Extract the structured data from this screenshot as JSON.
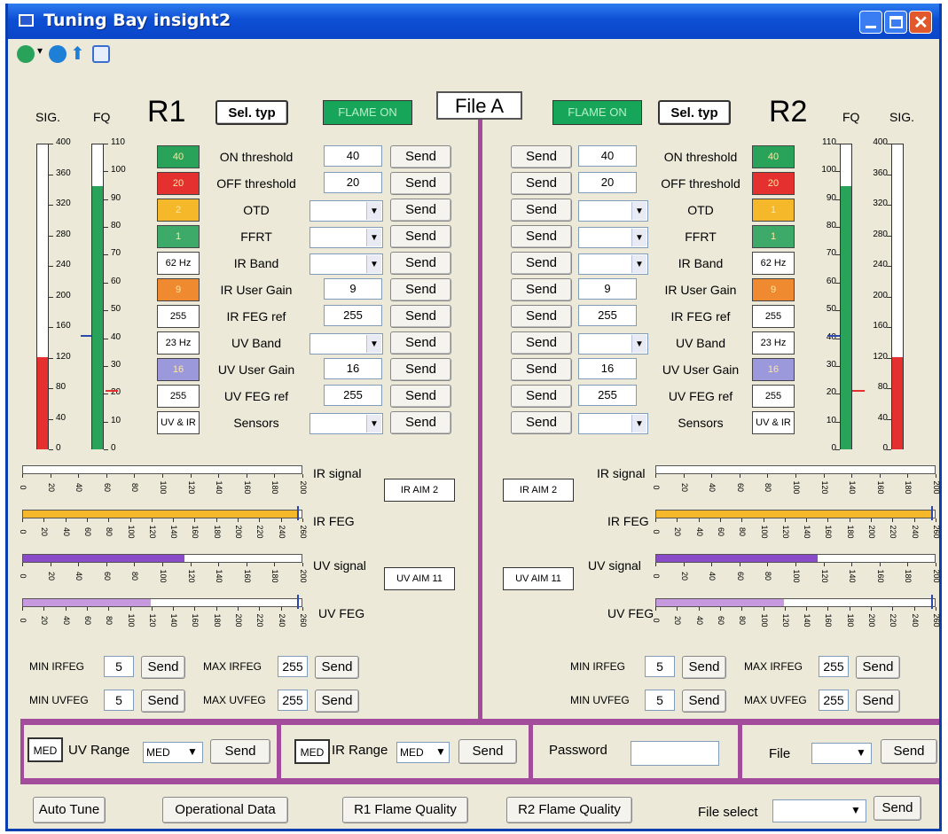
{
  "window": {
    "title": "Tuning Bay insight2"
  },
  "header": {
    "sig": "SIG.",
    "fq": "FQ",
    "r1": "R1",
    "r2": "R2",
    "sel_typ": "Sel. typ",
    "flame_on": "FLAME ON",
    "file": "File A"
  },
  "sig_scale": [
    "400",
    "360",
    "320",
    "280",
    "240",
    "200",
    "160",
    "120",
    "80",
    "40",
    "0"
  ],
  "fq_scale": [
    "110",
    "100",
    "90",
    "80",
    "70",
    "60",
    "50",
    "40",
    "30",
    "20",
    "10",
    "0"
  ],
  "levels": {
    "sig": 30,
    "fq": 86
  },
  "rows": [
    {
      "label": "ON threshold",
      "chip": "40",
      "chip_color": "#2aa35a",
      "value": "40",
      "type": "input",
      "style": ""
    },
    {
      "label": "OFF threshold",
      "chip": "20",
      "chip_color": "#e53030",
      "value": "20",
      "type": "input",
      "style": ""
    },
    {
      "label": "OTD",
      "chip": "2",
      "chip_color": "#f5b82a",
      "value": "",
      "type": "select",
      "style": ""
    },
    {
      "label": "FFRT",
      "chip": "1",
      "chip_color": "#3eaa6a",
      "value": "",
      "type": "select",
      "style": ""
    },
    {
      "label": "IR Band",
      "chip": "62 Hz",
      "chip_color": "#ffffff",
      "value": "",
      "type": "select",
      "style": "orange"
    },
    {
      "label": "IR User Gain",
      "chip": "9",
      "chip_color": "#f08a30",
      "value": "9",
      "type": "input",
      "style": "orange"
    },
    {
      "label": "IR FEG ref",
      "chip": "255",
      "chip_color": "#ffffff",
      "value": "255",
      "type": "input",
      "style": "orange"
    },
    {
      "label": "UV Band",
      "chip": "23 Hz",
      "chip_color": "#ffffff",
      "value": "",
      "type": "select",
      "style": "purple"
    },
    {
      "label": "UV User Gain",
      "chip": "16",
      "chip_color": "#9b98dc",
      "value": "16",
      "type": "input",
      "style": "purple"
    },
    {
      "label": "UV FEG ref",
      "chip": "255",
      "chip_color": "#ffffff",
      "value": "255",
      "type": "input",
      "style": "purple"
    },
    {
      "label": "Sensors",
      "chip": "UV & IR",
      "chip_color": "#ffffff",
      "value": "",
      "type": "select",
      "style": ""
    }
  ],
  "r2_chips": [
    "40",
    "20",
    "1",
    "1",
    "62 Hz",
    "9",
    "255",
    "23 Hz",
    "16",
    "255",
    "UV & IR"
  ],
  "send": "Send",
  "scales": {
    "signal": [
      "0",
      "20",
      "40",
      "60",
      "80",
      "100",
      "120",
      "140",
      "160",
      "180",
      "200"
    ],
    "feg": [
      "0",
      "20",
      "40",
      "60",
      "80",
      "100",
      "120",
      "140",
      "160",
      "180",
      "200",
      "220",
      "240",
      "260"
    ]
  },
  "bars": [
    {
      "label": "IR signal",
      "fill": 0,
      "color": "#f5b82a"
    },
    {
      "label": "IR FEG",
      "fill": 99,
      "color": "#f5b82a"
    },
    {
      "label": "UV signal",
      "fill": 58,
      "color": "#8a4bc8"
    },
    {
      "label": "UV FEG",
      "fill": 46,
      "color": "#c79ae0"
    }
  ],
  "aim": {
    "ir": "IR AIM 2",
    "uv": "UV AIM 11"
  },
  "minmax": {
    "min_irfeg": "MIN IRFEG",
    "max_irfeg": "MAX IRFEG",
    "min_uvfeg": "MIN UVFEG",
    "max_uvfeg": "MAX UVFEG",
    "min_val": "5",
    "max_val": "255"
  },
  "bottom": {
    "med": "MED",
    "uv_range": "UV Range",
    "ir_range": "IR Range",
    "password": "Password",
    "file": "File",
    "file_select": "File select"
  },
  "footer_buttons": [
    "Auto Tune",
    "Operational Data",
    "R1 Flame Quality",
    "R2 Flame Quality"
  ]
}
